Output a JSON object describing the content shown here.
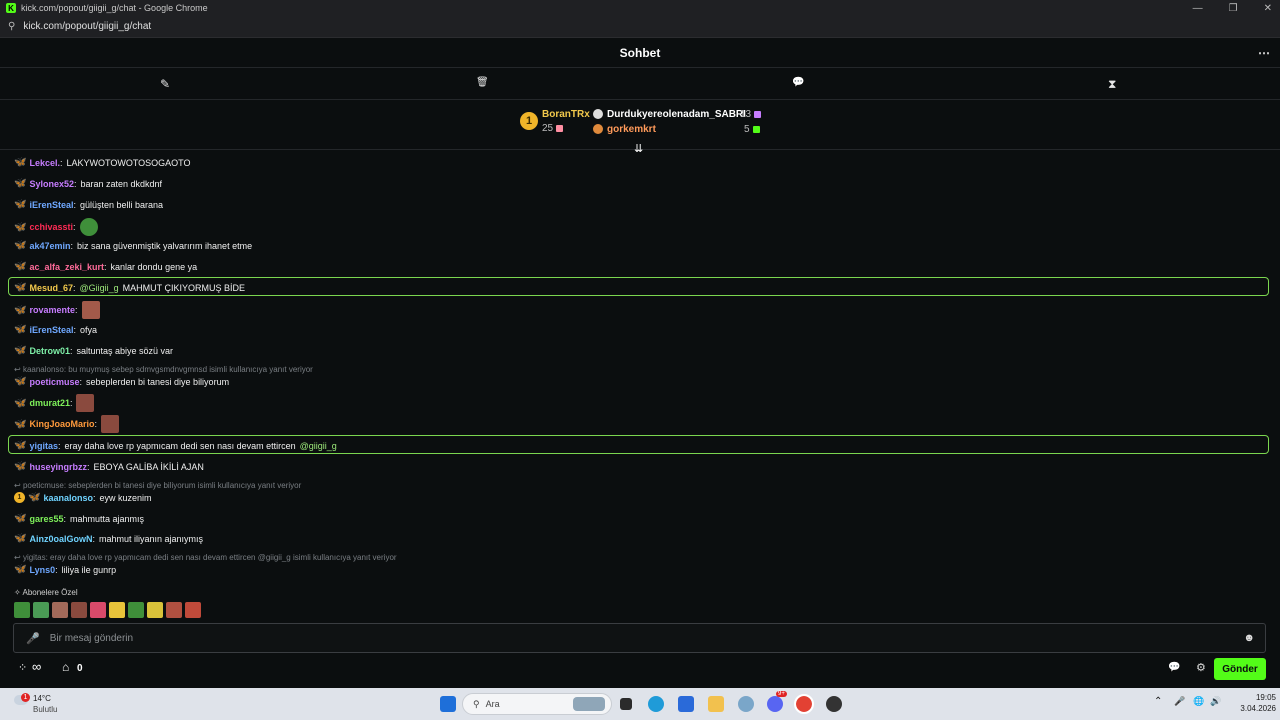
{
  "browser": {
    "window_title": "kick.com/popout/giigii_g/chat - Google Chrome",
    "url": "kick.com/popout/giigii_g/chat",
    "favicon_letter": "K",
    "min": "—",
    "max": "❐",
    "close": "✕",
    "tune_icon": "⚲"
  },
  "header": {
    "title": "Sohbet",
    "more": "⋯"
  },
  "toolbar": {
    "pin": "✎",
    "trash": "🗑",
    "chat": "💬",
    "hourglass": "⧗"
  },
  "leaderboard": {
    "first": {
      "rank": "1",
      "name": "BoranTRx",
      "value": "25"
    },
    "second": {
      "name": "Durdukyereolenadam_SABRI",
      "value": "13"
    },
    "third": {
      "name": "gorkemkrt",
      "value": "5"
    }
  },
  "scroll_icon": "⇊",
  "messages": [
    {
      "user": "Lekcel.",
      "color": "#c77dff",
      "text": "LAKYWOTOWOTOSOGAOTO"
    },
    {
      "user": "Sylonex52",
      "color": "#c77dff",
      "text": "baran zaten dkdkdnf"
    },
    {
      "user": "iErenSteal",
      "color": "#6fa8ff",
      "text": "gülüşten belli barana"
    },
    {
      "user": "cchivassti",
      "color": "#ff2b55",
      "text": ""
    },
    {
      "user": "ak47emin",
      "color": "#6fa8ff",
      "text": "biz sana güvenmiştik yalvarırım ihanet etme"
    },
    {
      "user": "ac_alfa_zeki_kurt",
      "color": "#ff6b9a",
      "text": "kanlar dondu gene ya"
    },
    {
      "user": "Mesud_67",
      "color": "#f2c94c",
      "mention": "@Giigii_g",
      "text": "MAHMUT ÇIKIYORMUŞ BİDE"
    },
    {
      "user": "rovamente",
      "color": "#c77dff",
      "text": ""
    },
    {
      "user": "iErenSteal",
      "color": "#6fa8ff",
      "text": "ofya"
    },
    {
      "user": "Detrow01",
      "color": "#7ef0a8",
      "text": "saltuntaş abiye sözü var"
    },
    {
      "reply": "kaanalonso: bu muymuş sebep sdmvgsmdnvgmnsd isimli kullanıcıya yanıt veriyor"
    },
    {
      "user": "poeticmuse",
      "color": "#c77dff",
      "text": "sebeplerden bi tanesi diye biliyorum"
    },
    {
      "user": "dmurat21",
      "color": "#7ef05a",
      "text": ""
    },
    {
      "user": "KingJoaoMario",
      "color": "#ff9a3c",
      "text": ""
    },
    {
      "user": "yigitas",
      "color": "#6fa8ff",
      "text": "eray daha love rp yapmıcam dedi sen nası devam ettircen",
      "mention_after": "@giigii_g"
    },
    {
      "user": "huseyingrbzz",
      "color": "#c77dff",
      "text": "EBOYA GALİBA İKİLİ AJAN"
    },
    {
      "reply": "poeticmuse: sebeplerden bi tanesi diye biliyorum isimli kullanıcıya yanıt veriyor"
    },
    {
      "user": "kaanalonso",
      "color": "#6fd3ff",
      "badge": "1",
      "text": "eyw kuzenim"
    },
    {
      "user": "gares55",
      "color": "#7ef05a",
      "text": "mahmutta ajanmış"
    },
    {
      "user": "Ainz0oalGowN",
      "color": "#6fd3ff",
      "text": "mahmut iliyanın ajanıymış"
    },
    {
      "reply": "yigitas: eray daha love rp yapmıcam dedi sen nası devam ettircen @giigii_g isimli kullanıcıya yanıt veriyor"
    },
    {
      "user": "Lyns0",
      "color": "#6fa8ff",
      "text": "liliya ile gunrp"
    }
  ],
  "emotes_label": "Abonelere Özel",
  "input": {
    "placeholder": "Bir mesaj gönderin",
    "mic_icon": "🎤",
    "emoji_icon": "☻"
  },
  "bottom": {
    "infinity": "∞",
    "store_count": "0",
    "send_label": "Gönder",
    "chat_icon": "💬",
    "settings_icon": "⚙",
    "store_icon": "⌂"
  },
  "taskbar": {
    "weather_temp": "14°C",
    "weather_desc": "Bulutlu",
    "weather_badge": "1",
    "search_placeholder": "Ara",
    "time": "19:05",
    "date": "3.04.2026",
    "tray_up": "⌃",
    "mic": "🎤",
    "network": "🌐",
    "volume": "🔊",
    "discord_badge": "9+"
  },
  "colors": {
    "accent": "#53fc18",
    "highlight_border": "#7bd64f"
  }
}
